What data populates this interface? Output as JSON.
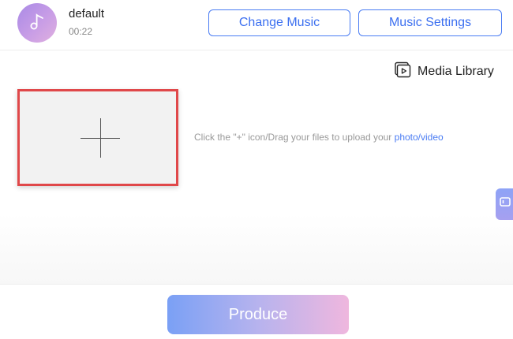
{
  "header": {
    "track_name": "default",
    "track_time": "00:22",
    "change_music_label": "Change Music",
    "music_settings_label": "Music Settings",
    "avatar_icon": "music-note-icon"
  },
  "main": {
    "media_library_label": "Media Library",
    "media_library_icon": "media-library-icon",
    "upload_icon": "plus-icon",
    "hint_text": "Click the \"+\" icon/Drag your files to upload your ",
    "hint_link": "photo/video",
    "side_tab_icon": "screen-icon"
  },
  "footer": {
    "produce_label": "Produce"
  },
  "colors": {
    "accent": "#4a7cf3",
    "highlight_border": "#e0484a",
    "upload_bg": "#f2f2f2",
    "produce_gradient_start": "#7aa0f5",
    "produce_gradient_end": "#efb7de"
  }
}
